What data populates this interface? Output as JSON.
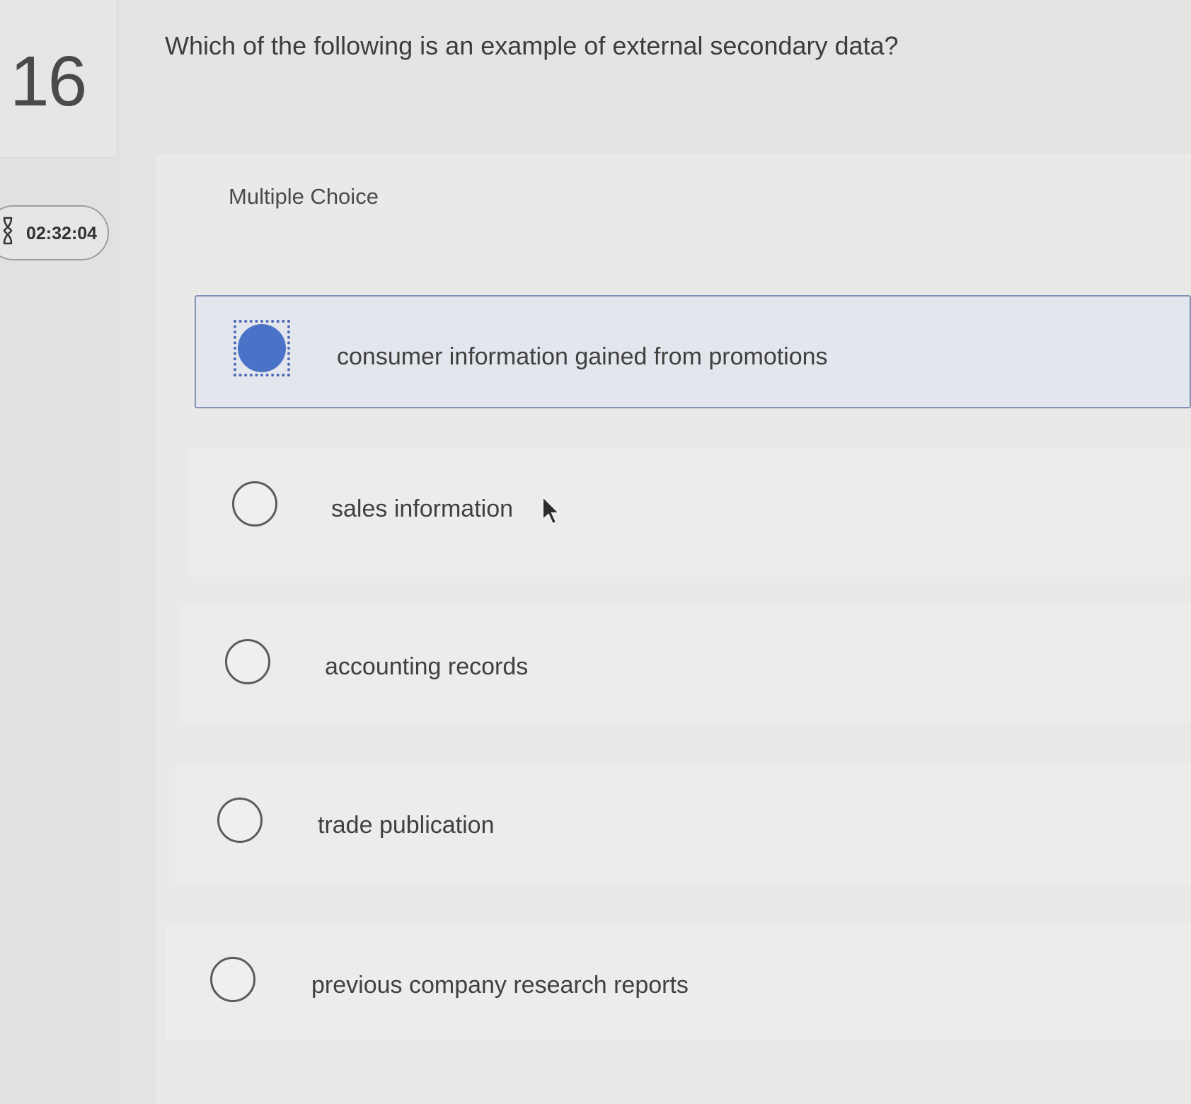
{
  "question": {
    "number": "16",
    "text": "Which of the following is an example of external secondary data?",
    "timer": "02:32:04"
  },
  "answer_section": {
    "type_label": "Multiple Choice",
    "options": [
      {
        "label": "consumer information gained from promotions",
        "selected": true
      },
      {
        "label": "sales information",
        "selected": false
      },
      {
        "label": "accounting records",
        "selected": false
      },
      {
        "label": "trade publication",
        "selected": false
      },
      {
        "label": "previous company research reports",
        "selected": false
      }
    ]
  },
  "colors": {
    "selected_radio": "#4a73c7",
    "selected_border": "#8392b6",
    "focus_ring": "#4d68b8"
  },
  "icons": {
    "timer": "hourglass-icon",
    "pointer": "mouse-cursor-icon"
  }
}
